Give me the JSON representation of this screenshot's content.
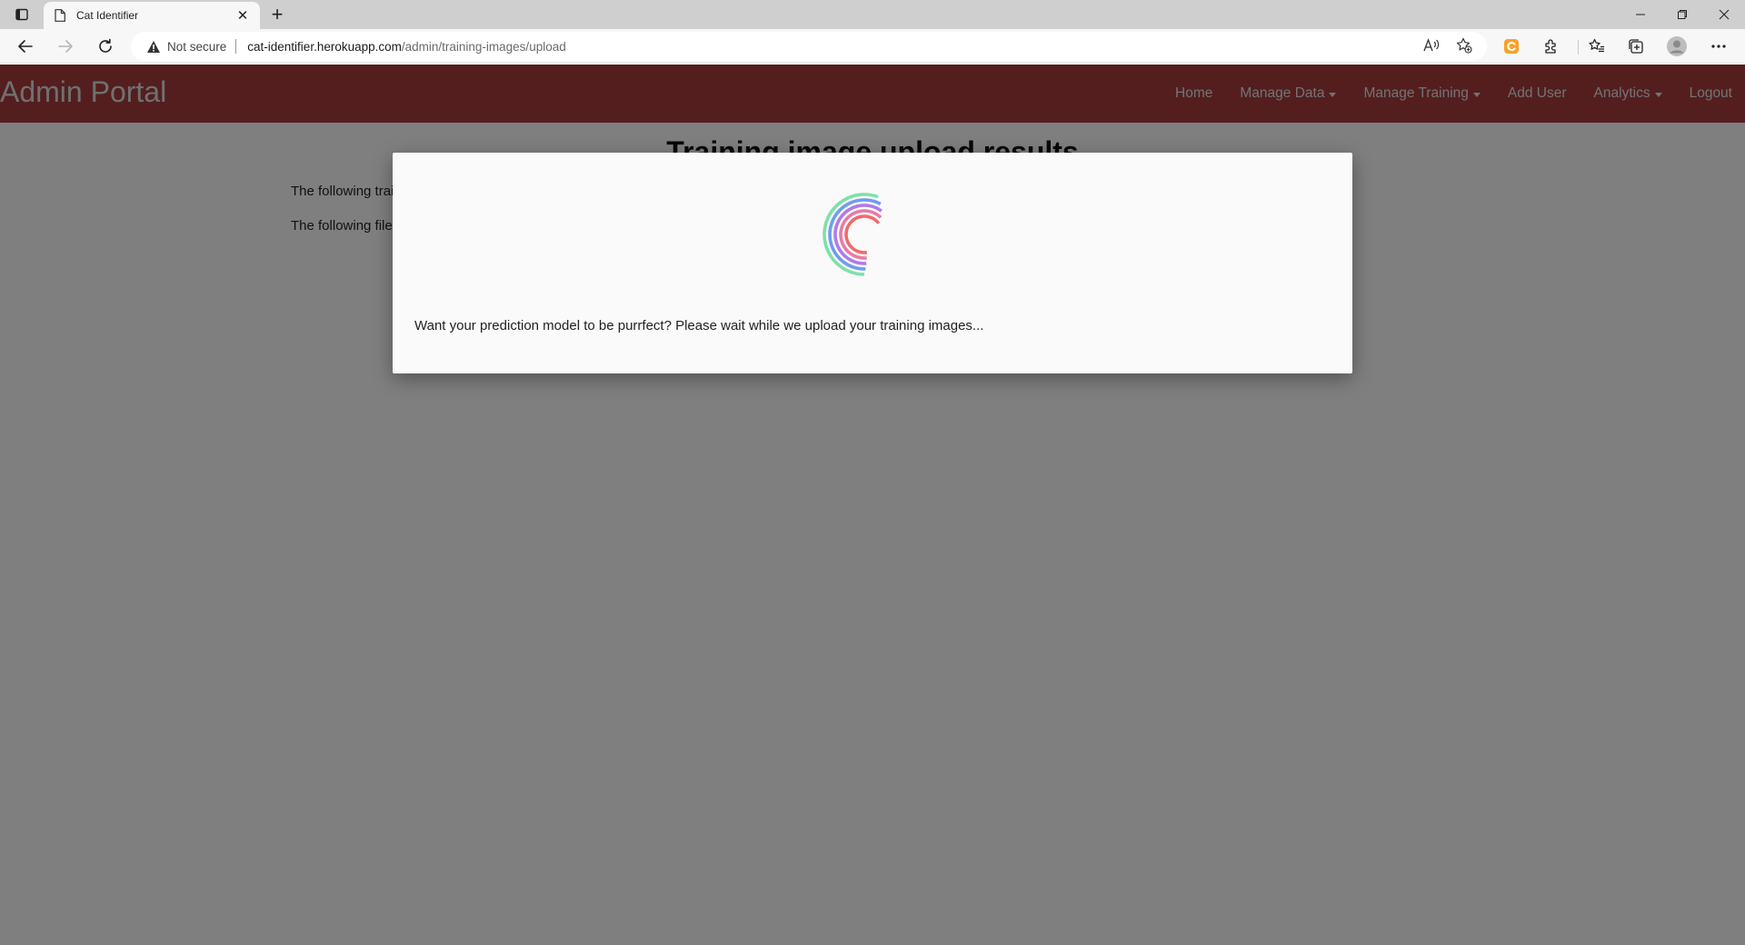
{
  "browser": {
    "tab_title": "Cat Identifier",
    "new_tab_symbol": "+",
    "close_symbol": "✕",
    "security_label": "Not secure",
    "url_host": "cat-identifier.herokuapp.com",
    "url_path": "/admin/training-images/upload",
    "icons": [
      "tab-actions-icon",
      "page-icon",
      "back-icon",
      "forward-icon",
      "refresh-icon",
      "warning-icon",
      "read-aloud-icon",
      "favorite-add-icon",
      "extension-orange-icon",
      "extensions-icon",
      "favorites-icon",
      "collections-icon",
      "profile-icon",
      "more-icon",
      "minimize-icon",
      "restore-icon",
      "close-icon"
    ]
  },
  "navbar": {
    "brand": "Admin Portal",
    "links": {
      "home": "Home",
      "manage_data": "Manage Data",
      "manage_training": "Manage Training",
      "add_user": "Add User",
      "analytics": "Analytics",
      "logout": "Logout"
    },
    "color": "#a83d3d"
  },
  "content": {
    "heading": "Training image upload results",
    "line1": "The following trai",
    "line2": "The following file"
  },
  "modal": {
    "message": "Want your prediction model to be purrfect? Please wait while we upload your training images...",
    "spinner_colors": [
      "#7ee0a8",
      "#6f9cf0",
      "#b07be8",
      "#e87aa8",
      "#f06a6a"
    ]
  }
}
